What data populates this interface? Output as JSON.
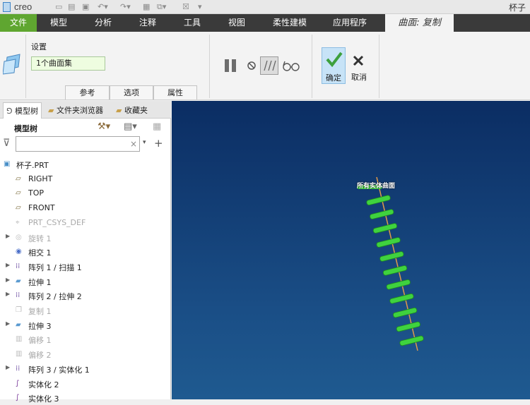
{
  "app": {
    "brand": "creo",
    "window_title": "杯子"
  },
  "ribbon_tabs": [
    "文件",
    "模型",
    "分析",
    "注释",
    "工具",
    "视图",
    "柔性建模",
    "应用程序"
  ],
  "active_context_tab": "曲面: 复制",
  "ribbon": {
    "settings_label": "设置",
    "surface_collector_value": "1个曲面集",
    "subtabs": [
      "参考",
      "选项",
      "属性"
    ],
    "confirm_label": "确定",
    "cancel_label": "取消"
  },
  "sidebar": {
    "tabs": [
      "模型树",
      "文件夹浏览器",
      "收藏夹"
    ],
    "tree_title": "模型树",
    "search_value": "",
    "items": [
      {
        "label": "杯子.PRT",
        "icon": "part-icon",
        "expandable": false,
        "dim": false
      },
      {
        "label": "RIGHT",
        "icon": "datum-plane-icon",
        "expandable": false,
        "dim": false
      },
      {
        "label": "TOP",
        "icon": "datum-plane-icon",
        "expandable": false,
        "dim": false
      },
      {
        "label": "FRONT",
        "icon": "datum-plane-icon",
        "expandable": false,
        "dim": false
      },
      {
        "label": "PRT_CSYS_DEF",
        "icon": "csys-icon",
        "expandable": false,
        "dim": true
      },
      {
        "label": "旋转 1",
        "icon": "revolve-icon",
        "expandable": true,
        "dim": true
      },
      {
        "label": "相交 1",
        "icon": "intersect-icon",
        "expandable": false,
        "dim": false
      },
      {
        "label": "阵列 1 / 扫描 1",
        "icon": "pattern-icon",
        "expandable": true,
        "dim": false
      },
      {
        "label": "拉伸 1",
        "icon": "extrude-icon",
        "expandable": true,
        "dim": false
      },
      {
        "label": "阵列 2 / 拉伸 2",
        "icon": "pattern-icon",
        "expandable": true,
        "dim": false
      },
      {
        "label": "复制 1",
        "icon": "copy-icon",
        "expandable": false,
        "dim": true
      },
      {
        "label": "拉伸 3",
        "icon": "extrude-icon",
        "expandable": true,
        "dim": false
      },
      {
        "label": "偏移 1",
        "icon": "offset-icon",
        "expandable": false,
        "dim": true
      },
      {
        "label": "偏移 2",
        "icon": "offset-icon",
        "expandable": false,
        "dim": true
      },
      {
        "label": "阵列 3 / 实体化 1",
        "icon": "pattern-icon",
        "expandable": true,
        "dim": false
      },
      {
        "label": "实体化 2",
        "icon": "solidify-icon",
        "expandable": false,
        "dim": false
      },
      {
        "label": "实体化 3",
        "icon": "solidify-icon",
        "expandable": false,
        "dim": false
      }
    ]
  },
  "viewport": {
    "selection_label": "所有实体曲面"
  },
  "colors": {
    "file_tab": "#5fa630",
    "ribbon_bar": "#3a3a3a",
    "viewport_bg": "#0b2d63",
    "surface_highlight": "#3fd23f"
  }
}
